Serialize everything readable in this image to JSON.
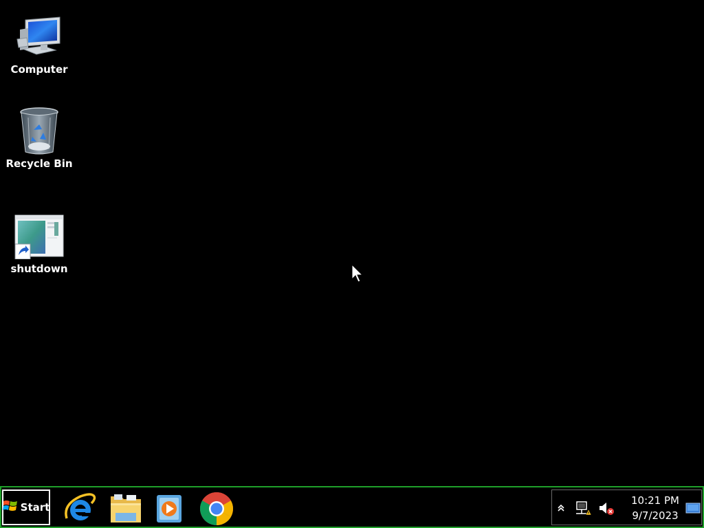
{
  "desktop": {
    "background_color": "#000000",
    "icons": [
      {
        "label": "Computer",
        "icon": "computer-icon"
      },
      {
        "label": "Recycle Bin",
        "icon": "recycle-bin-icon"
      },
      {
        "label": "shutdown",
        "icon": "shortcut-icon"
      }
    ]
  },
  "taskbar": {
    "border_color": "#1fa12a",
    "start_label": "Start",
    "pinned": [
      {
        "name": "Internet Explorer",
        "icon": "internet-explorer-icon"
      },
      {
        "name": "File Explorer",
        "icon": "folder-icon"
      },
      {
        "name": "Windows Media Player",
        "icon": "media-player-icon"
      },
      {
        "name": "Google Chrome",
        "icon": "chrome-icon"
      }
    ],
    "tray": {
      "icons": [
        "show-hidden-icons-chevron-icon",
        "network-warning-icon",
        "volume-muted-icon"
      ],
      "time": "10:21 PM",
      "date": "9/7/2023"
    }
  }
}
